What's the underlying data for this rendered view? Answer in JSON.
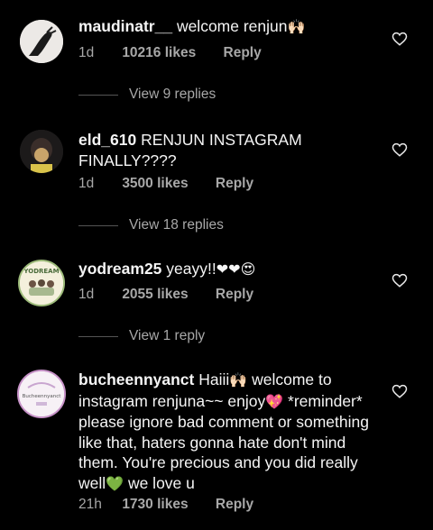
{
  "comments": [
    {
      "username": "maudinatr__",
      "text": "welcome renjun",
      "emoji": "🙌🏻",
      "time": "1d",
      "likes": "10216 likes",
      "reply_label": "Reply",
      "view_replies": "View 9 replies"
    },
    {
      "username": "eld_610",
      "text": "RENJUN INSTAGRAM FINALLY????",
      "time": "1d",
      "likes": "3500 likes",
      "reply_label": "Reply",
      "view_replies": "View 18 replies"
    },
    {
      "username": "yodream25",
      "text": "yeayy!!",
      "emoji": "❤❤😍",
      "avatar_text": "YODREAM",
      "time": "1d",
      "likes": "2055 likes",
      "reply_label": "Reply",
      "view_replies": "View 1 reply"
    },
    {
      "username": "bucheennyanct",
      "text_1": "Haiii",
      "emoji_1": "🙌🏻",
      "text_2": "welcome to instagram renjuna~~ enjoy",
      "emoji_2": "💖",
      "text_3": "*reminder* please ignore bad comment or something like that, haters gonna hate don't mind them. You're precious and you did really well",
      "emoji_3": "💚",
      "text_4": "we love u",
      "avatar_text": "Bucheennyanct",
      "time": "21h",
      "likes": "1730 likes",
      "reply_label": "Reply"
    }
  ]
}
